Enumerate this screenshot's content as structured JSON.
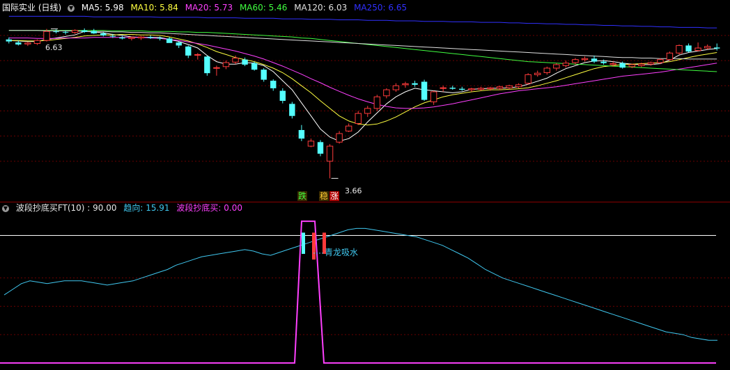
{
  "colors": {
    "background": "#000000",
    "up_candle": "#ff3b3b",
    "down_candle": "#54ffff",
    "grid": "#6b0000",
    "ma5": "#ffffff",
    "ma10": "#ffff40",
    "ma20": "#ff40ff",
    "ma60": "#40ff40",
    "ma120": "#e0e0e0",
    "ma250": "#3030ff",
    "trend": "#40c8f0",
    "buy": "#ff40ff",
    "hline": "#ffffff"
  },
  "main_header": {
    "title": "国际实业 (日线)",
    "menu_icon": "chevron-down-icon",
    "ma5": "MA5: 5.98",
    "ma10": "MA10: 5.84",
    "ma20": "MA20: 5.73",
    "ma60": "MA60: 5.46",
    "ma120": "MA120: 6.03",
    "ma250": "MA250: 6.65"
  },
  "main_annotations": {
    "high_label": "6.63",
    "low_label": "3.66",
    "signal_die": "跌",
    "signal_wen": "稳",
    "signal_zhang": "涨"
  },
  "sub_header": {
    "name": "波段抄底买FT(10) : 90.00",
    "trend": "趋向: 15.91",
    "buy": "波段抄底买: 0.00"
  },
  "sub_annotations": {
    "qinglong": "青龙吸水"
  },
  "chart_data": [
    {
      "type": "candlestick",
      "name": "main",
      "y_range": [
        3.5,
        6.9
      ],
      "candles": [
        [
          6.42,
          6.46,
          6.34,
          6.38
        ],
        [
          6.36,
          6.4,
          6.3,
          6.32
        ],
        [
          6.33,
          6.37,
          6.29,
          6.35
        ],
        [
          6.34,
          6.42,
          6.31,
          6.4
        ],
        [
          6.4,
          6.63,
          6.38,
          6.58
        ],
        [
          6.58,
          6.62,
          6.54,
          6.57
        ],
        [
          6.57,
          6.6,
          6.52,
          6.56
        ],
        [
          6.56,
          6.62,
          6.53,
          6.6
        ],
        [
          6.6,
          6.64,
          6.55,
          6.57
        ],
        [
          6.59,
          6.63,
          6.53,
          6.54
        ],
        [
          6.54,
          6.57,
          6.48,
          6.5
        ],
        [
          6.49,
          6.53,
          6.45,
          6.48
        ],
        [
          6.46,
          6.49,
          6.42,
          6.44
        ],
        [
          6.44,
          6.48,
          6.4,
          6.46
        ],
        [
          6.45,
          6.49,
          6.41,
          6.47
        ],
        [
          6.47,
          6.5,
          6.43,
          6.45
        ],
        [
          6.45,
          6.48,
          6.4,
          6.44
        ],
        [
          6.44,
          6.47,
          6.38,
          6.35
        ],
        [
          6.36,
          6.38,
          6.25,
          6.3
        ],
        [
          6.28,
          6.3,
          6.05,
          6.1
        ],
        [
          6.12,
          6.15,
          6.02,
          6.12
        ],
        [
          6.08,
          6.1,
          5.7,
          5.75
        ],
        [
          5.85,
          5.9,
          5.7,
          5.86
        ],
        [
          5.88,
          6.0,
          5.83,
          5.96
        ],
        [
          5.97,
          6.1,
          5.93,
          6.05
        ],
        [
          6.02,
          6.06,
          5.89,
          5.92
        ],
        [
          5.95,
          5.98,
          5.8,
          5.82
        ],
        [
          5.82,
          5.85,
          5.58,
          5.62
        ],
        [
          5.6,
          5.63,
          5.4,
          5.45
        ],
        [
          5.4,
          5.45,
          5.15,
          5.2
        ],
        [
          5.14,
          5.18,
          4.85,
          4.9
        ],
        [
          4.62,
          4.72,
          4.4,
          4.45
        ],
        [
          4.3,
          4.45,
          4.28,
          4.4
        ],
        [
          4.38,
          4.42,
          4.1,
          4.15
        ],
        [
          4.0,
          4.34,
          3.66,
          4.3
        ],
        [
          4.38,
          4.6,
          4.35,
          4.55
        ],
        [
          4.6,
          4.75,
          4.58,
          4.7
        ],
        [
          4.75,
          5.0,
          4.72,
          4.95
        ],
        [
          4.95,
          5.1,
          4.88,
          5.05
        ],
        [
          5.05,
          5.32,
          5.0,
          5.28
        ],
        [
          5.3,
          5.45,
          5.25,
          5.42
        ],
        [
          5.42,
          5.55,
          5.38,
          5.5
        ],
        [
          5.52,
          5.58,
          5.46,
          5.54
        ],
        [
          5.55,
          5.6,
          5.48,
          5.52
        ],
        [
          5.58,
          5.62,
          5.2,
          5.22
        ],
        [
          5.18,
          5.4,
          5.12,
          5.38
        ],
        [
          5.45,
          5.5,
          5.38,
          5.46
        ],
        [
          5.46,
          5.5,
          5.42,
          5.44
        ],
        [
          5.44,
          5.48,
          5.4,
          5.42
        ],
        [
          5.42,
          5.46,
          5.38,
          5.44
        ],
        [
          5.43,
          5.48,
          5.4,
          5.45
        ],
        [
          5.44,
          5.48,
          5.4,
          5.46
        ],
        [
          5.45,
          5.5,
          5.41,
          5.48
        ],
        [
          5.46,
          5.52,
          5.43,
          5.5
        ],
        [
          5.48,
          5.55,
          5.45,
          5.52
        ],
        [
          5.55,
          5.75,
          5.52,
          5.72
        ],
        [
          5.72,
          5.8,
          5.68,
          5.75
        ],
        [
          5.76,
          5.88,
          5.72,
          5.85
        ],
        [
          5.85,
          5.95,
          5.8,
          5.92
        ],
        [
          5.9,
          6.0,
          5.86,
          5.95
        ],
        [
          5.96,
          6.05,
          5.92,
          6.02
        ],
        [
          6.02,
          6.08,
          5.98,
          6.04
        ],
        [
          6.04,
          6.1,
          5.95,
          5.98
        ],
        [
          5.98,
          6.02,
          5.92,
          5.95
        ],
        [
          5.92,
          5.98,
          5.88,
          5.94
        ],
        [
          5.95,
          5.98,
          5.84,
          5.86
        ],
        [
          5.88,
          5.94,
          5.85,
          5.92
        ],
        [
          5.9,
          5.96,
          5.87,
          5.93
        ],
        [
          5.93,
          5.98,
          5.9,
          5.96
        ],
        [
          5.96,
          6.05,
          5.93,
          6.02
        ],
        [
          6.02,
          6.18,
          6.0,
          6.15
        ],
        [
          6.15,
          6.32,
          6.12,
          6.3
        ],
        [
          6.3,
          6.34,
          6.16,
          6.18
        ],
        [
          6.2,
          6.36,
          6.18,
          6.25
        ],
        [
          6.25,
          6.32,
          6.22,
          6.28
        ],
        [
          6.26,
          6.34,
          6.2,
          6.24
        ]
      ],
      "moving_averages": {
        "MA5": [
          6.4,
          6.39,
          6.38,
          6.38,
          6.42,
          6.45,
          6.48,
          6.51,
          6.58,
          6.57,
          6.55,
          6.52,
          6.5,
          6.47,
          6.46,
          6.46,
          6.46,
          6.42,
          6.38,
          6.32,
          6.25,
          6.1,
          5.98,
          5.93,
          5.93,
          5.96,
          5.95,
          5.9,
          5.78,
          5.6,
          5.42,
          5.16,
          4.9,
          4.64,
          4.48,
          4.4,
          4.45,
          4.58,
          4.78,
          4.96,
          5.14,
          5.28,
          5.38,
          5.45,
          5.42,
          5.4,
          5.38,
          5.36,
          5.38,
          5.43,
          5.44,
          5.45,
          5.45,
          5.46,
          5.48,
          5.53,
          5.59,
          5.65,
          5.75,
          5.84,
          5.9,
          5.96,
          5.99,
          6.0,
          5.98,
          5.95,
          5.93,
          5.92,
          5.92,
          5.94,
          6.01,
          6.11,
          6.16,
          6.19,
          6.22,
          6.24
        ],
        "MA10": [
          6.4,
          6.4,
          6.39,
          6.39,
          6.4,
          6.42,
          6.44,
          6.46,
          6.49,
          6.5,
          6.51,
          6.51,
          6.52,
          6.52,
          6.51,
          6.51,
          6.5,
          6.47,
          6.43,
          6.39,
          6.33,
          6.26,
          6.18,
          6.12,
          6.06,
          6.02,
          5.98,
          5.92,
          5.85,
          5.76,
          5.64,
          5.5,
          5.36,
          5.2,
          5.05,
          4.9,
          4.8,
          4.74,
          4.72,
          4.74,
          4.8,
          4.88,
          4.98,
          5.08,
          5.16,
          5.22,
          5.28,
          5.32,
          5.35,
          5.38,
          5.4,
          5.42,
          5.42,
          5.43,
          5.44,
          5.46,
          5.5,
          5.55,
          5.6,
          5.66,
          5.72,
          5.78,
          5.84,
          5.88,
          5.9,
          5.92,
          5.93,
          5.94,
          5.95,
          5.96,
          5.98,
          6.02,
          6.06,
          6.1,
          6.13,
          6.16
        ],
        "MA20": [
          6.45,
          6.45,
          6.45,
          6.44,
          6.44,
          6.44,
          6.45,
          6.45,
          6.45,
          6.46,
          6.46,
          6.46,
          6.46,
          6.46,
          6.46,
          6.45,
          6.44,
          6.42,
          6.4,
          6.37,
          6.34,
          6.31,
          6.27,
          6.23,
          6.19,
          6.14,
          6.09,
          6.03,
          5.96,
          5.89,
          5.81,
          5.73,
          5.64,
          5.56,
          5.47,
          5.39,
          5.31,
          5.24,
          5.18,
          5.13,
          5.09,
          5.06,
          5.05,
          5.05,
          5.06,
          5.08,
          5.11,
          5.14,
          5.18,
          5.22,
          5.26,
          5.3,
          5.34,
          5.37,
          5.4,
          5.42,
          5.44,
          5.46,
          5.48,
          5.51,
          5.54,
          5.57,
          5.6,
          5.63,
          5.66,
          5.69,
          5.71,
          5.73,
          5.75,
          5.77,
          5.8,
          5.83,
          5.86,
          5.89,
          5.92,
          5.95
        ],
        "MA60": [
          6.6,
          6.6,
          6.6,
          6.6,
          6.6,
          6.6,
          6.6,
          6.6,
          6.6,
          6.6,
          6.6,
          6.59,
          6.59,
          6.59,
          6.59,
          6.58,
          6.58,
          6.58,
          6.57,
          6.57,
          6.56,
          6.56,
          6.55,
          6.54,
          6.53,
          6.52,
          6.51,
          6.5,
          6.49,
          6.48,
          6.47,
          6.45,
          6.44,
          6.42,
          6.4,
          6.38,
          6.36,
          6.34,
          6.32,
          6.3,
          6.28,
          6.26,
          6.24,
          6.22,
          6.2,
          6.18,
          6.16,
          6.14,
          6.12,
          6.1,
          6.08,
          6.06,
          6.04,
          6.02,
          6.0,
          5.98,
          5.97,
          5.96,
          5.95,
          5.94,
          5.93,
          5.92,
          5.91,
          5.9,
          5.89,
          5.88,
          5.87,
          5.86,
          5.85,
          5.84,
          5.83,
          5.82,
          5.81,
          5.8,
          5.79,
          5.78
        ],
        "MA120": [
          6.6,
          6.6,
          6.6,
          6.6,
          6.59,
          6.59,
          6.59,
          6.59,
          6.58,
          6.58,
          6.58,
          6.57,
          6.57,
          6.56,
          6.56,
          6.55,
          6.55,
          6.54,
          6.53,
          6.52,
          6.51,
          6.5,
          6.49,
          6.48,
          6.47,
          6.46,
          6.45,
          6.44,
          6.43,
          6.42,
          6.41,
          6.4,
          6.39,
          6.38,
          6.37,
          6.36,
          6.35,
          6.34,
          6.33,
          6.32,
          6.31,
          6.3,
          6.29,
          6.28,
          6.27,
          6.26,
          6.25,
          6.24,
          6.23,
          6.22,
          6.21,
          6.2,
          6.19,
          6.18,
          6.17,
          6.16,
          6.15,
          6.14,
          6.13,
          6.12,
          6.11,
          6.1,
          6.09,
          6.08,
          6.07,
          6.06,
          6.06,
          6.05,
          6.05,
          6.04,
          6.04,
          6.04,
          6.03,
          6.03,
          6.03,
          6.03
        ],
        "MA250": [
          6.88,
          6.88,
          6.88,
          6.88,
          6.88,
          6.88,
          6.88,
          6.88,
          6.88,
          6.87,
          6.87,
          6.87,
          6.87,
          6.87,
          6.87,
          6.87,
          6.86,
          6.86,
          6.86,
          6.86,
          6.86,
          6.85,
          6.85,
          6.85,
          6.85,
          6.84,
          6.84,
          6.84,
          6.84,
          6.83,
          6.83,
          6.83,
          6.82,
          6.82,
          6.82,
          6.81,
          6.81,
          6.81,
          6.8,
          6.8,
          6.8,
          6.79,
          6.79,
          6.79,
          6.78,
          6.78,
          6.78,
          6.77,
          6.77,
          6.77,
          6.76,
          6.76,
          6.76,
          6.75,
          6.75,
          6.74,
          6.74,
          6.73,
          6.73,
          6.72,
          6.72,
          6.71,
          6.71,
          6.7,
          6.7,
          6.69,
          6.69,
          6.68,
          6.68,
          6.67,
          6.67,
          6.66,
          6.66,
          6.66,
          6.65,
          6.65
        ]
      }
    },
    {
      "type": "line",
      "name": "sub",
      "y_range": [
        -2,
        105
      ],
      "reference_line": 90,
      "series": [
        {
          "name": "趋向",
          "values": [
            48,
            52,
            56,
            58,
            57,
            56,
            57,
            58,
            58,
            58,
            57,
            56,
            55,
            56,
            57,
            58,
            60,
            62,
            64,
            66,
            69,
            71,
            73,
            75,
            76,
            77,
            78,
            79,
            80,
            79,
            77,
            76,
            78,
            80,
            82,
            84,
            86,
            88,
            90,
            92,
            94,
            95,
            95,
            94,
            93,
            92,
            91,
            90,
            89,
            87,
            85,
            83,
            80,
            77,
            74,
            70,
            66,
            63,
            60,
            58,
            56,
            54,
            52,
            50,
            48,
            46,
            44,
            42,
            40,
            38,
            36,
            34,
            32,
            30,
            28,
            26,
            24,
            22,
            21,
            20,
            18,
            17,
            16,
            16
          ]
        },
        {
          "name": "波段抄底买",
          "values": [
            0,
            0,
            0,
            0,
            0,
            0,
            0,
            0,
            0,
            0,
            0,
            0,
            0,
            0,
            0,
            0,
            0,
            0,
            0,
            0,
            0,
            0,
            0,
            0,
            0,
            0,
            0,
            0,
            0,
            0,
            0,
            0,
            0,
            0,
            0,
            0,
            0,
            0,
            0,
            0,
            0,
            0,
            0,
            0,
            0,
            0,
            0,
            0,
            0,
            0,
            0,
            0,
            0,
            0,
            0,
            0,
            0,
            0,
            0,
            0,
            0,
            0,
            0,
            0,
            0,
            0,
            0,
            0,
            0,
            0,
            0,
            0,
            0,
            0,
            0,
            0,
            0,
            0,
            0,
            0,
            0,
            0,
            0,
            0
          ]
        }
      ],
      "buy_pulse": {
        "from": 0,
        "peak": 100
      },
      "signal_bars": [
        {
          "top": 92,
          "bottom": 77,
          "color": "down"
        },
        {
          "top": 92,
          "bottom": 73,
          "color": "up"
        },
        {
          "top": 92,
          "bottom": 77,
          "color": "up"
        }
      ]
    }
  ]
}
